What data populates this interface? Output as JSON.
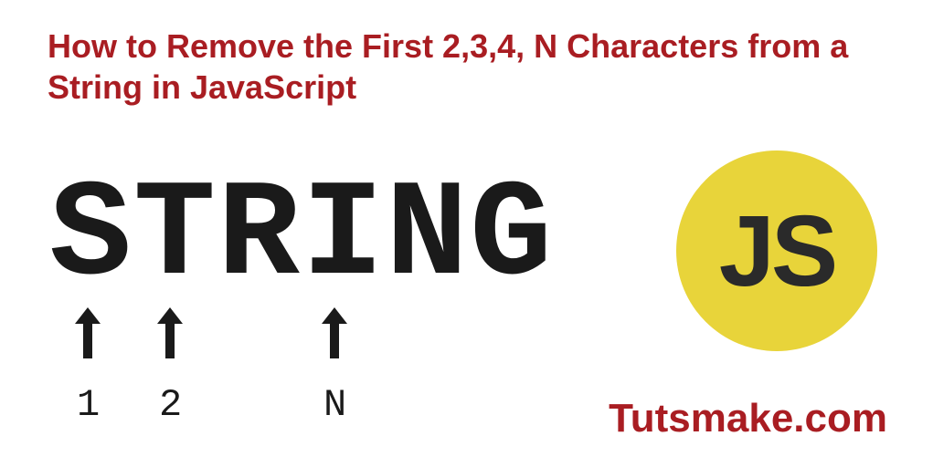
{
  "title": "How to Remove the First 2,3,4, N Characters from a String in JavaScript",
  "stringWord": "STRING",
  "indices": {
    "first": "1",
    "second": "2",
    "nth": "N"
  },
  "jsBadge": "JS",
  "brand": "Tutsmake.com",
  "colors": {
    "accent": "#a91d22",
    "jsYellow": "#e8d43a",
    "text": "#1a1a1a"
  }
}
